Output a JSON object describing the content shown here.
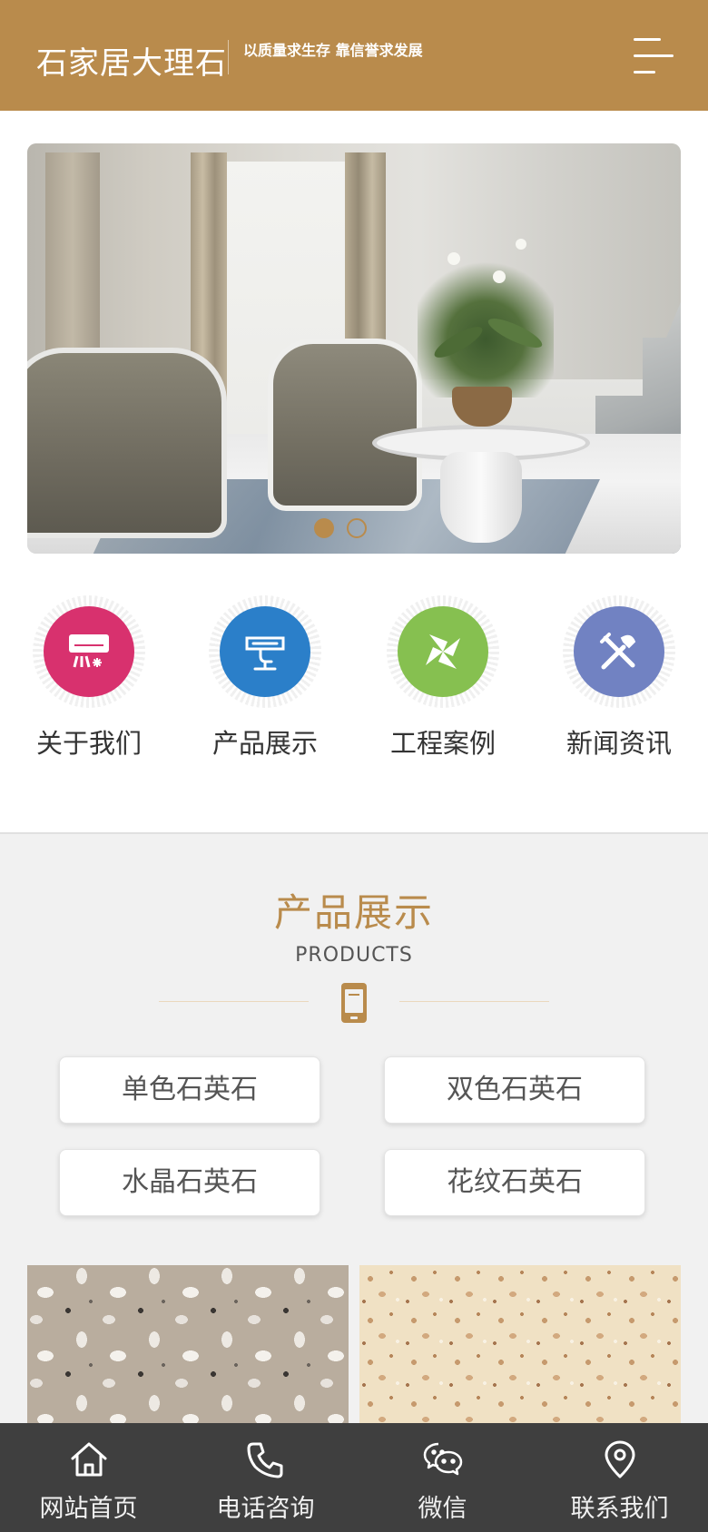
{
  "header": {
    "logo_text": "石家居大理石",
    "slogan": "以质量求生存 靠信誉求发展",
    "menu_icon": "hamburger-menu-icon"
  },
  "banner": {
    "slide_count": 2,
    "active_slide": 1
  },
  "quick_nav": [
    {
      "label": "关于我们",
      "icon": "air-conditioner-icon",
      "color": "#d8316e"
    },
    {
      "label": "产品展示",
      "icon": "air-vent-icon",
      "color": "#2b7fc9"
    },
    {
      "label": "工程案例",
      "icon": "pinwheel-icon",
      "color": "#86c050"
    },
    {
      "label": "新闻资讯",
      "icon": "tools-icon",
      "color": "#7182c2"
    }
  ],
  "products": {
    "title": "产品展示",
    "subtitle": "PRODUCTS",
    "icon": "phone-device-icon",
    "categories": [
      "单色石英石",
      "双色石英石",
      "水晶石英石",
      "花纹石英石"
    ]
  },
  "bottom_nav": [
    {
      "label": "网站首页",
      "icon": "home-icon"
    },
    {
      "label": "电话咨询",
      "icon": "phone-icon"
    },
    {
      "label": "微信",
      "icon": "wechat-icon"
    },
    {
      "label": "联系我们",
      "icon": "location-pin-icon"
    }
  ],
  "colors": {
    "brand": "#b98b4c",
    "bottom_bar": "#3f3f3f",
    "page_bg": "#f1f1f1"
  }
}
